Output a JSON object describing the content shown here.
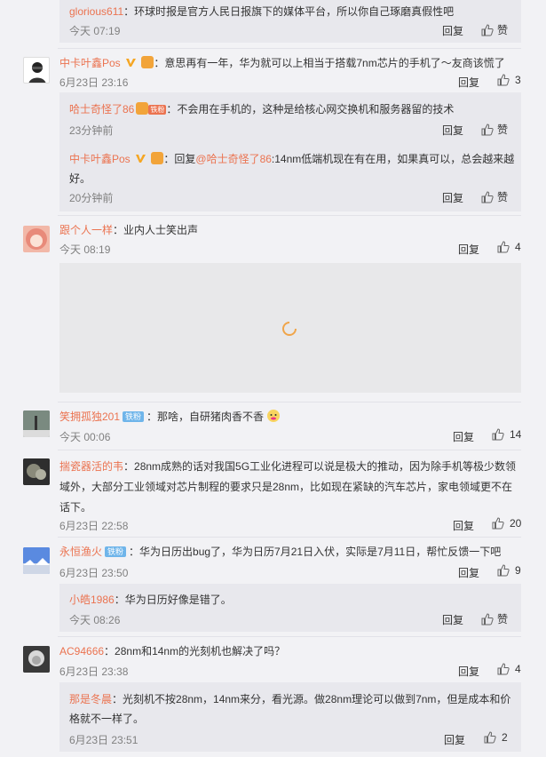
{
  "actions": {
    "reply": "回复",
    "like_label": "赞"
  },
  "comments": [
    {
      "reply_top": {
        "nick": "glorious611",
        "text": "：环球时报是官方人民日报旗下的媒体平台，所以你自己琢磨真假性吧",
        "time": "今天 07:19"
      }
    },
    {
      "nick": "中卡叶鑫Pos",
      "text": "：意思再有一年，华为就可以上相当于搭载7nm芯片的手机了～友商该慌了",
      "time": "6月23日 23:16",
      "likes": "3",
      "replies": [
        {
          "nick": "哈士奇怪了86",
          "badge": "铁粉",
          "text": "：不会用在手机的，这种是给核心网交换机和服务器留的技术",
          "time": "23分钟前"
        },
        {
          "nick": "中卡叶鑫Pos",
          "text_prefix": "：回复",
          "mention": "@哈士奇怪了86",
          "text": ":14nm低端机现在有在用，如果真可以，总会越来越好。",
          "time": "20分钟前"
        }
      ]
    },
    {
      "nick": "跟个人一样",
      "text": "：业内人士笑出声",
      "time": "今天 08:19",
      "likes": "4"
    },
    {
      "nick": "笑拥孤独201",
      "badge": "铁粉",
      "text": "：那啥，自研猪肉香不香",
      "time": "今天 00:06",
      "likes": "14"
    },
    {
      "nick": "揣瓷器活的韦",
      "text": "：28nm成熟的话对我国5G工业化进程可以说是极大的推动，因为除手机等极少数领域外，大部分工业领域对芯片制程的要求只是28nm，比如现在紧缺的汽车芯片，家电领域更不在话下。",
      "time": "6月23日 22:58",
      "likes": "20"
    },
    {
      "nick": "永恒渔火",
      "badge": "铁粉",
      "text": "：华为日历出bug了，华为日历7月21日入伏，实际是7月11日，帮忙反馈一下吧",
      "time": "6月23日 23:50",
      "likes": "9",
      "replies": [
        {
          "nick": "小皓1986",
          "text": "：华为日历好像是错了。",
          "time": "今天 08:26"
        }
      ]
    },
    {
      "nick": "AC94666",
      "text": "：28nm和14nm的光刻机也解决了吗？",
      "time": "6月23日 23:38",
      "likes": "4",
      "replies": [
        {
          "nick": "那是冬晨",
          "text": "：光刻机不按28nm，14nm来分，看光源。做28nm理论可以做到7nm，但是成本和价格就不一样了。",
          "time": "6月23日 23:51",
          "likes": "2"
        }
      ]
    }
  ]
}
